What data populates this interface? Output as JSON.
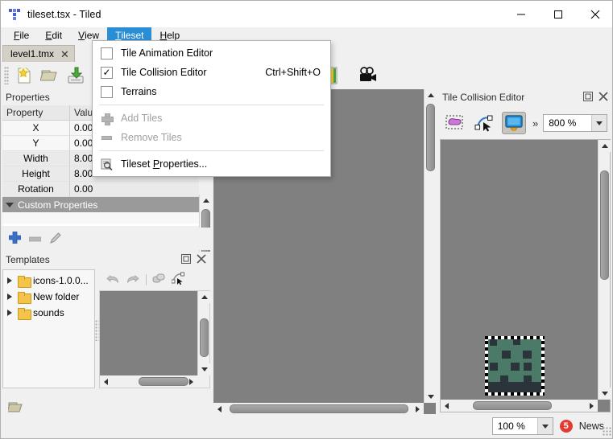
{
  "window": {
    "title": "tileset.tsx - Tiled",
    "app_icon": "tiled-logo-icon",
    "minimize_label": "—",
    "maximize_label": "□",
    "close_label": "✕"
  },
  "menubar": {
    "items": [
      {
        "label": "File",
        "mnemonic": "F",
        "active": false
      },
      {
        "label": "Edit",
        "mnemonic": "E",
        "active": false
      },
      {
        "label": "View",
        "mnemonic": "V",
        "active": false
      },
      {
        "label": "Tileset",
        "mnemonic": "T",
        "active": true
      },
      {
        "label": "Help",
        "mnemonic": "H",
        "active": false
      }
    ]
  },
  "tileset_menu": {
    "open": true,
    "items": [
      {
        "label": "Tile Animation Editor",
        "type": "checkbox",
        "checked": false,
        "enabled": true,
        "shortcut": ""
      },
      {
        "label": "Tile Collision Editor",
        "type": "checkbox",
        "checked": true,
        "enabled": true,
        "shortcut": "Ctrl+Shift+O"
      },
      {
        "label": "Terrains",
        "type": "checkbox",
        "checked": false,
        "enabled": true,
        "shortcut": ""
      },
      {
        "separator": true
      },
      {
        "label": "Add Tiles",
        "type": "icon",
        "icon": "plus-icon",
        "enabled": false,
        "shortcut": ""
      },
      {
        "label": "Remove Tiles",
        "type": "icon",
        "icon": "minus-icon",
        "enabled": false,
        "shortcut": ""
      },
      {
        "separator": true
      },
      {
        "label": "Tileset Properties...",
        "type": "icon",
        "icon": "tileset-properties-icon",
        "enabled": true,
        "shortcut": "",
        "mnemonic": "P"
      }
    ]
  },
  "tabbar": {
    "tabs": [
      {
        "label": "level1.tmx",
        "active": true,
        "close_glyph": "✕"
      }
    ]
  },
  "main_toolbar": {
    "buttons": [
      {
        "name": "new-map-button",
        "icon": "new-file-icon"
      },
      {
        "name": "open-file-button",
        "icon": "open-folder-icon"
      },
      {
        "name": "save-file-button",
        "icon": "save-disk-icon"
      }
    ],
    "right_buttons": [
      {
        "name": "tilesets-button",
        "icon": "color-gradient-icon"
      },
      {
        "name": "animation-button",
        "icon": "movie-camera-icon"
      }
    ]
  },
  "properties_dock": {
    "title": "Properties",
    "columns": [
      "Property",
      "Value"
    ],
    "rows": [
      {
        "property": "X",
        "value": "0.00"
      },
      {
        "property": "Y",
        "value": "0.00"
      },
      {
        "property": "Width",
        "value": "8.00"
      },
      {
        "property": "Height",
        "value": "8.00"
      },
      {
        "property": "Rotation",
        "value": "0.00"
      }
    ],
    "group": {
      "label": "Custom Properties",
      "expanded": true
    },
    "toolbar": [
      {
        "name": "add-property-button",
        "icon": "plus-icon",
        "enabled": true
      },
      {
        "name": "remove-property-button",
        "icon": "minus-icon",
        "enabled": false
      },
      {
        "name": "edit-property-button",
        "icon": "pencil-icon",
        "enabled": false
      }
    ]
  },
  "templates_dock": {
    "title": "Templates",
    "header_icons": [
      {
        "name": "float-panel-icon",
        "glyph": "▣"
      },
      {
        "name": "close-panel-icon",
        "glyph": "✕"
      }
    ],
    "items": [
      {
        "label": "icons-1.0.0...",
        "icon": "folder-icon",
        "expanded": false
      },
      {
        "label": "New folder",
        "icon": "folder-icon",
        "expanded": false
      },
      {
        "label": "sounds",
        "icon": "folder-icon",
        "expanded": false
      }
    ],
    "toolbar": [
      {
        "name": "undo-button",
        "icon": "undo-arrow-icon",
        "enabled": false
      },
      {
        "name": "redo-button",
        "icon": "redo-arrow-icon",
        "enabled": false
      },
      {
        "name": "select-object-button",
        "icon": "object-select-icon",
        "enabled": false
      },
      {
        "name": "edit-polygon-button",
        "icon": "edit-polygon-icon",
        "enabled": false
      }
    ],
    "footer_icon": {
      "name": "open-templates-folder-icon"
    }
  },
  "tile_collision_editor": {
    "title": "Tile Collision Editor",
    "header_icons": [
      {
        "name": "float-panel-icon",
        "glyph": "▣"
      },
      {
        "name": "close-panel-icon",
        "glyph": "✕"
      }
    ],
    "toolbar": [
      {
        "name": "select-objects-button",
        "icon": "rubber-band-select-icon",
        "active": false
      },
      {
        "name": "edit-polygons-button",
        "icon": "edit-polygon-icon",
        "active": false
      },
      {
        "name": "toggle-highlight-button",
        "icon": "monitor-icon",
        "active": true
      }
    ],
    "overflow_glyph": "»",
    "zoom": {
      "value": "800 %",
      "dropdown_glyph": "▼"
    },
    "tile": {
      "name": "collision-tile-preview",
      "base_color": "#4b7a68",
      "detail_color": "#2b333b",
      "selection_border": "dashed-marching-ants"
    }
  },
  "statusbar": {
    "zoom": {
      "value": "100 %",
      "dropdown_glyph": "▼"
    },
    "news": {
      "count": "5",
      "label": "News"
    }
  }
}
